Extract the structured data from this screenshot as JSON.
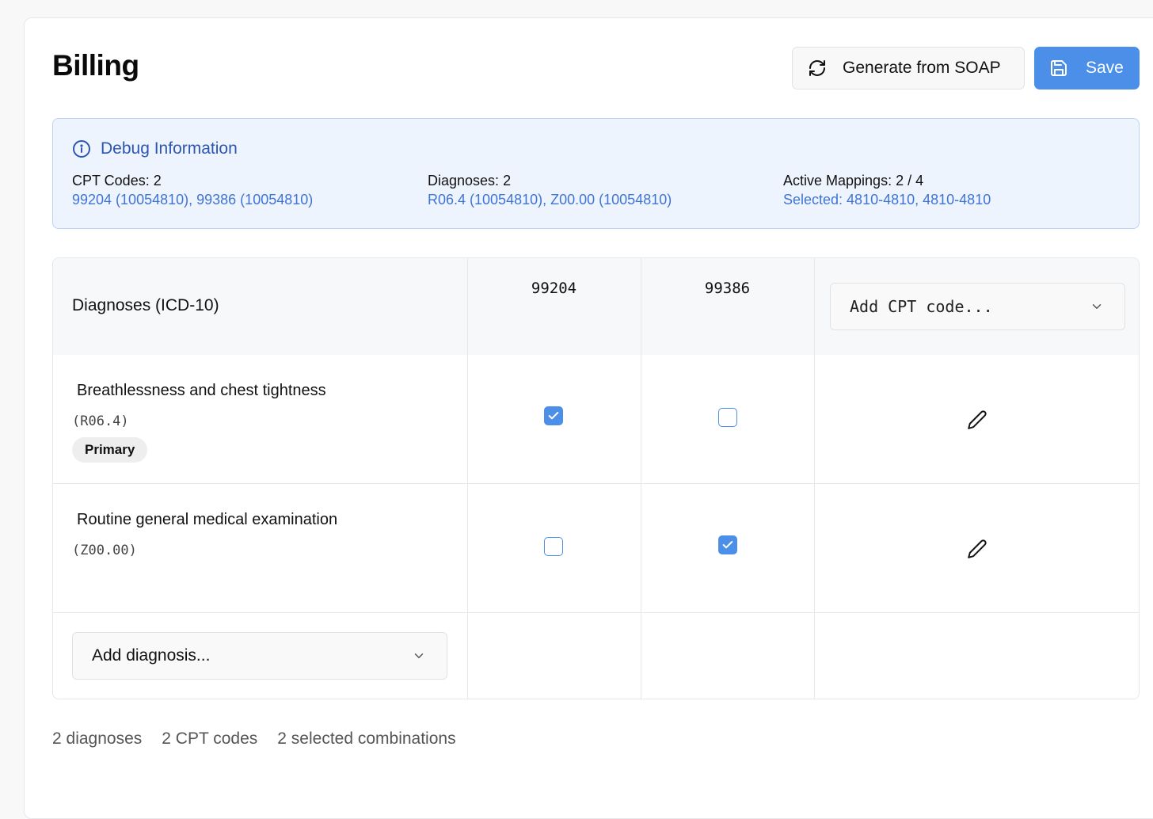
{
  "header": {
    "title": "Billing",
    "generate_label": "Generate from SOAP",
    "save_label": "Save"
  },
  "debug": {
    "title": "Debug Information",
    "cpt": {
      "label": "CPT Codes:",
      "count": "2",
      "detail": "99204 (10054810), 99386 (10054810)"
    },
    "diagnoses": {
      "label": "Diagnoses:",
      "count": "2",
      "detail": "R06.4 (10054810), Z00.00 (10054810)"
    },
    "mappings": {
      "label": "Active Mappings:",
      "count": "2 / 4",
      "detail": "Selected: 4810-4810, 4810-4810"
    }
  },
  "table": {
    "header_label": "Diagnoses (ICD-10)",
    "cpt_codes": [
      "99204",
      "99386"
    ],
    "add_cpt_placeholder": "Add CPT code...",
    "rows": [
      {
        "name": "Breathlessness and chest tightness",
        "code": "(R06.4)",
        "badge": "Primary",
        "checked": [
          true,
          false
        ]
      },
      {
        "name": "Routine general medical examination",
        "code": "(Z00.00)",
        "badge": "",
        "checked": [
          false,
          true
        ]
      }
    ],
    "add_diagnosis_placeholder": "Add diagnosis..."
  },
  "footer": {
    "diagnoses": "2 diagnoses",
    "cpt_codes": "2 CPT codes",
    "combinations": "2 selected combinations"
  },
  "colors": {
    "accent": "#4b8fe9",
    "debug_text": "#2d56b3",
    "debug_bg": "#eef4fe"
  }
}
